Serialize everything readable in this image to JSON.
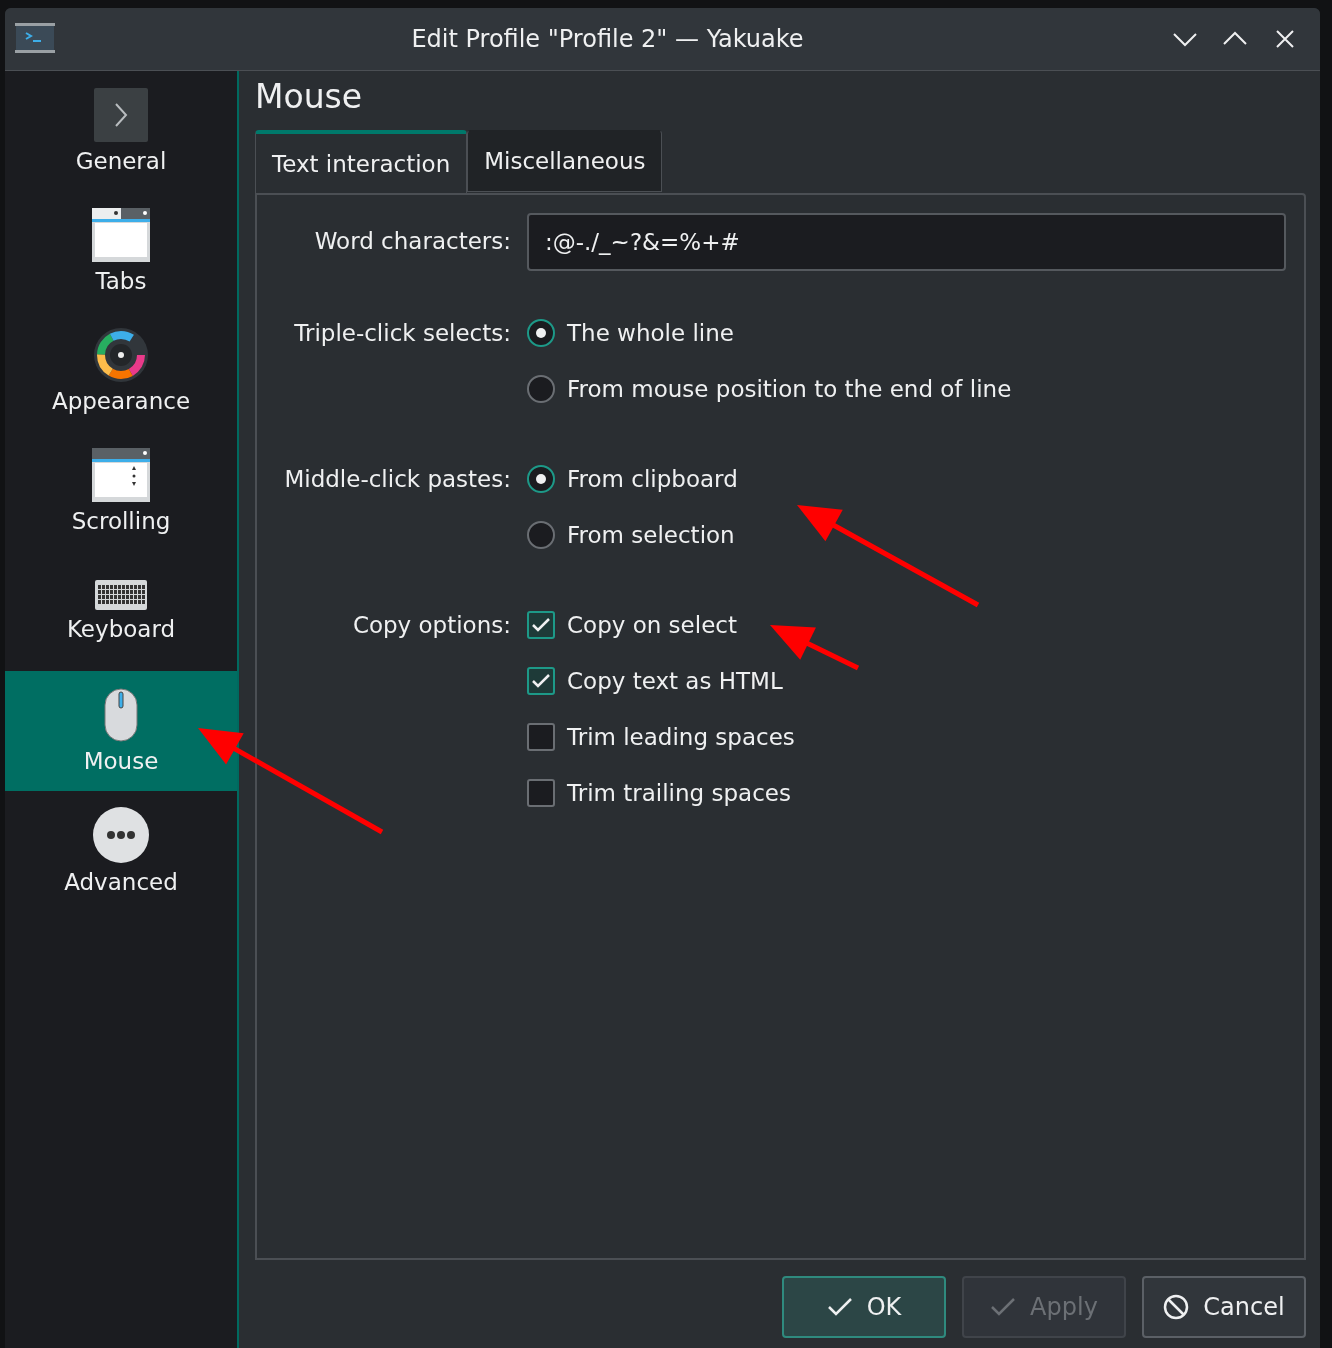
{
  "window": {
    "title": "Edit Profile \"Profile 2\" — Yakuake"
  },
  "sidebar": {
    "items": [
      {
        "label": "General",
        "kind": "general",
        "selected": false
      },
      {
        "label": "Tabs",
        "kind": "tabs",
        "selected": false
      },
      {
        "label": "Appearance",
        "kind": "appearance",
        "selected": false
      },
      {
        "label": "Scrolling",
        "kind": "scrolling",
        "selected": false
      },
      {
        "label": "Keyboard",
        "kind": "keyboard",
        "selected": false
      },
      {
        "label": "Mouse",
        "kind": "mouse",
        "selected": true
      },
      {
        "label": "Advanced",
        "kind": "advanced",
        "selected": false
      }
    ]
  },
  "page": {
    "title": "Mouse"
  },
  "tabs": [
    {
      "label": "Text interaction",
      "selected": true
    },
    {
      "label": "Miscellaneous",
      "selected": false
    }
  ],
  "form": {
    "rows": [
      {
        "kind": "text",
        "label": "Word characters:",
        "value": ":@-./_~?&=%+#"
      },
      {
        "kind": "radio",
        "label": "Triple-click selects:",
        "options": [
          {
            "label": "The whole line",
            "selected": true
          },
          {
            "label": "From mouse position to the end of line",
            "selected": false
          }
        ]
      },
      {
        "kind": "radio",
        "label": "Middle-click pastes:",
        "options": [
          {
            "label": "From clipboard",
            "selected": true
          },
          {
            "label": "From selection",
            "selected": false
          }
        ]
      },
      {
        "kind": "checkbox",
        "label": "Copy options:",
        "options": [
          {
            "label": "Copy on select",
            "checked": true
          },
          {
            "label": "Copy text as HTML",
            "checked": true
          },
          {
            "label": "Trim leading spaces",
            "checked": false
          },
          {
            "label": "Trim trailing spaces",
            "checked": false
          }
        ]
      }
    ]
  },
  "buttons": [
    {
      "kind": "ok",
      "label": "OK",
      "disabled": false
    },
    {
      "kind": "apply",
      "label": "Apply",
      "disabled": true
    },
    {
      "kind": "cancel",
      "label": "Cancel",
      "disabled": false
    }
  ]
}
